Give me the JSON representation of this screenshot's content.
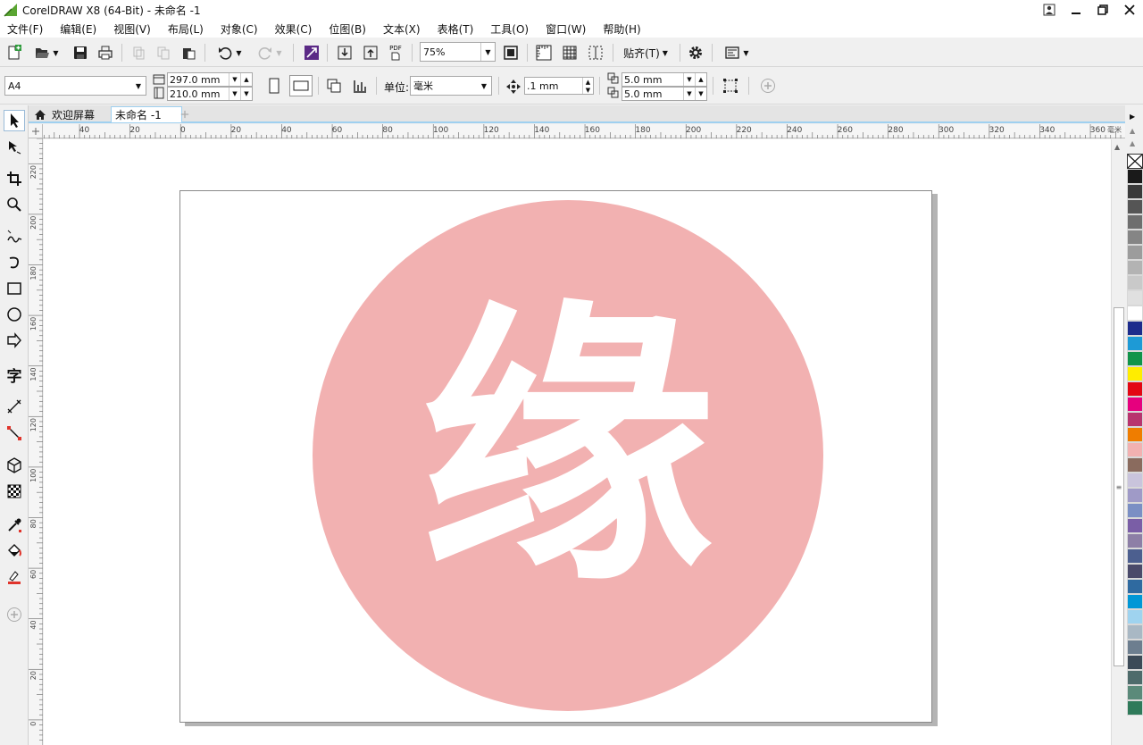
{
  "app": {
    "title": "CorelDRAW X8 (64-Bit) - 未命名 -1",
    "window_controls": [
      "minimize",
      "restore",
      "close"
    ]
  },
  "menu": {
    "items": [
      "文件(F)",
      "编辑(E)",
      "视图(V)",
      "布局(L)",
      "对象(C)",
      "效果(C)",
      "位图(B)",
      "文本(X)",
      "表格(T)",
      "工具(O)",
      "窗口(W)",
      "帮助(H)"
    ]
  },
  "toolbar": {
    "zoom_value": "75%",
    "pdf_label": "PDF",
    "snap_label": "贴齐(T)"
  },
  "property_bar": {
    "page_size": "A4",
    "width": "297.0 mm",
    "height": "210.0 mm",
    "units_label": "单位:",
    "units_value": "毫米",
    "nudge": ".1 mm",
    "dup_x": "5.0 mm",
    "dup_y": "5.0 mm"
  },
  "tabs": [
    {
      "label": "欢迎屏幕",
      "icon": "home-icon",
      "active": false
    },
    {
      "label": "未命名 -1",
      "active": true
    }
  ],
  "rulers": {
    "horizontal_labels": [
      "40",
      "20",
      "0",
      "20",
      "40",
      "60",
      "80",
      "100",
      "120",
      "140",
      "160",
      "180",
      "200",
      "220",
      "240",
      "260",
      "280",
      "300",
      "320",
      "340",
      "360"
    ],
    "vertical_labels": [
      "220",
      "200",
      "180",
      "160",
      "140",
      "120",
      "100",
      "80",
      "60",
      "40",
      "20",
      "0"
    ],
    "unit_mark": "毫米"
  },
  "document": {
    "glyph": "缘",
    "circle_color": "#f2b1b1",
    "glyph_color": "#ffffff"
  },
  "palette": {
    "colors": [
      "#1a1a1a",
      "#3a3a3a",
      "#555555",
      "#6e6e6e",
      "#858585",
      "#9c9c9c",
      "#b3b3b3",
      "#c9c9c9",
      "#e0e0e0",
      "#ffffff",
      "#1c2b8c",
      "#1d9ad6",
      "#11944a",
      "#ffed00",
      "#e30613",
      "#e6007e",
      "#b8346e",
      "#ef7d00",
      "#f2b1b1",
      "#8a6b5e",
      "#c9c4dc",
      "#9f9ac7",
      "#7b8fc4",
      "#7a5ea6",
      "#8d7fa6",
      "#4c5f8f",
      "#4a4a6a",
      "#2f6aa0",
      "#0097d6",
      "#9fd3ef",
      "#a9b8c4",
      "#6d7e8f",
      "#3c4a57",
      "#4e6b6b",
      "#5b8a7a",
      "#2f7a5a"
    ]
  }
}
